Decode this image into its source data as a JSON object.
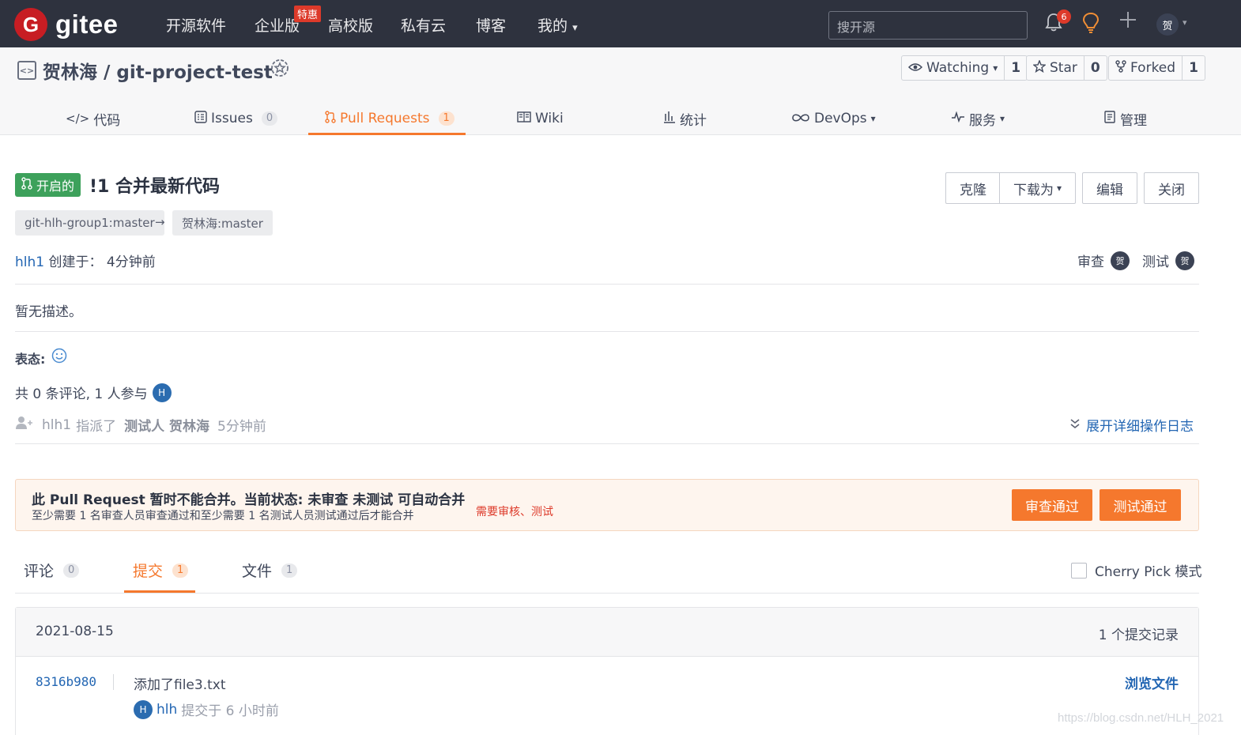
{
  "brand": {
    "mark": "G",
    "name": "gitee"
  },
  "nav": {
    "items": [
      "开源软件",
      "企业版",
      "高校版",
      "私有云",
      "博客",
      "我的"
    ],
    "hot_badge": "特惠",
    "caret": "▾",
    "search_placeholder": "搜开源",
    "notification_count": "6",
    "avatar": "贺"
  },
  "repo": {
    "title": "贺林海 / git-project-test",
    "watching_label": "Watching",
    "watching_count": "1",
    "star_label": "Star",
    "star_count": "0",
    "forked_label": "Forked",
    "forked_count": "1",
    "tabs": [
      {
        "label": "代码"
      },
      {
        "label": "Issues",
        "count": "0"
      },
      {
        "label": "Pull Requests",
        "count": "1"
      },
      {
        "label": "Wiki"
      },
      {
        "label": "统计"
      },
      {
        "label": "DevOps"
      },
      {
        "label": "服务"
      },
      {
        "label": "管理"
      }
    ]
  },
  "pr": {
    "status": "开启的",
    "title": "!1 合并最新代码",
    "buttons": {
      "clone": "克隆",
      "download": "下载为",
      "edit": "编辑",
      "close": "关闭"
    },
    "source_branch": "git-hlh-group1:master",
    "arrow": "→",
    "target_branch": "贺林海:master",
    "author": "hlh1",
    "created_label": "创建于：",
    "created_time": "4分钟前",
    "reviewer_label": "审查",
    "tester_label": "测试",
    "reviewer_avatar": "贺",
    "tester_avatar": "贺",
    "description": "暂无描述。",
    "reaction_label": "表态:",
    "comment_summary": "共 0 条评论, 1 人参与",
    "participant_avatar": "H",
    "event": {
      "actor": "hlh1",
      "verb": "指派了",
      "target": "测试人 贺林海",
      "time": "5分钟前"
    },
    "expand_log": "展开详细操作日志"
  },
  "merge": {
    "title": "此 Pull Request 暂时不能合并。当前状态: 未审查 未测试 可自动合并",
    "subtitle": "至少需要 1 名审查人员审查通过和至少需要 1 名测试人员测试通过后才能合并",
    "need": "需要审核、测试",
    "review_button": "审查通过",
    "test_button": "测试通过"
  },
  "subtabs": [
    {
      "label": "评论",
      "count": "0"
    },
    {
      "label": "提交",
      "count": "1"
    },
    {
      "label": "文件",
      "count": "1"
    }
  ],
  "cherry_pick_label": "Cherry Pick 模式",
  "commits": {
    "date": "2021-08-15",
    "total": "1 个提交记录",
    "items": [
      {
        "sha": "8316b980",
        "message": "添加了file3.txt",
        "avatar": "H",
        "author": "hlh",
        "meta": "提交于 6 小时前",
        "browse": "浏览文件"
      }
    ]
  },
  "watermark": "https://blog.csdn.net/HLH_2021"
}
